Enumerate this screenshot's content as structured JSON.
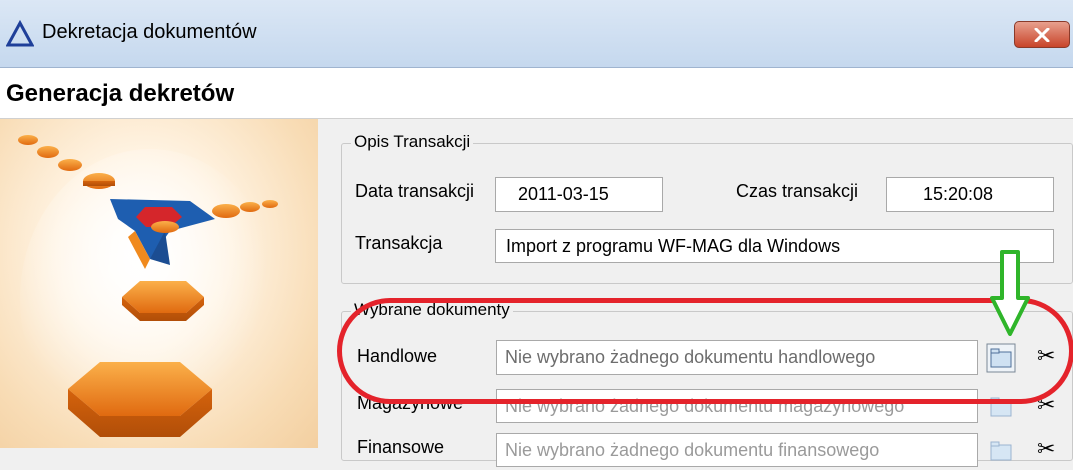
{
  "window": {
    "title": "Dekretacja dokumentów",
    "close_icon": "close-icon"
  },
  "heading": "Generacja dekretów",
  "transaction": {
    "group_title": "Opis Transakcji",
    "date_label": "Data transakcji",
    "date_value": "2011-03-15",
    "time_label": "Czas transakcji",
    "time_value": "15:20:08",
    "transaction_label": "Transakcja",
    "transaction_value": "Import z programu WF-MAG dla Windows"
  },
  "documents": {
    "group_title": "Wybrane dokumenty",
    "rows": [
      {
        "label": "Handlowe",
        "value": "Nie wybrano żadnego dokumentu handlowego"
      },
      {
        "label": "Magazynowe",
        "value": "Nie wybrano żadnego dokumentu magazynowego"
      },
      {
        "label": "Finansowe",
        "value": "Nie wybrano żadnego dokumentu finansowego"
      }
    ]
  },
  "colors": {
    "annotation_oval": "#e4232b",
    "annotation_arrow": "#2fb52a",
    "hexagon_orange": "#f08a1e"
  }
}
